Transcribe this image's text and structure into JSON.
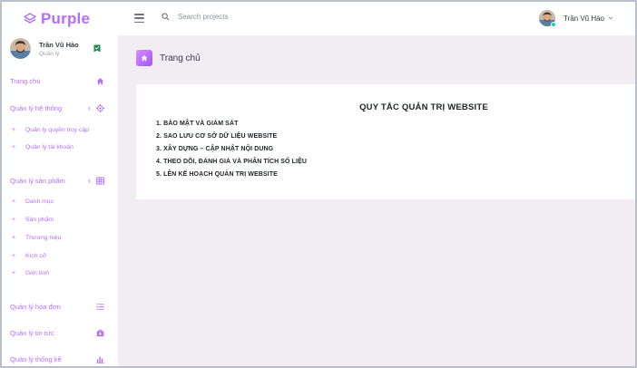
{
  "brand": {
    "name": "Purple"
  },
  "topbar": {
    "search_placeholder": "Search projects",
    "user_name": "Trần Vũ Hào"
  },
  "profile": {
    "name": "Trần Vũ Hào",
    "role": "Quản lý"
  },
  "sidebar": {
    "home": {
      "label": "Trang chủ",
      "icon": "home-icon"
    },
    "system": {
      "label": "Quản lý hệ thống",
      "icon": "crosshairs-icon",
      "sub": [
        "Quản lý quyền truy cập",
        "Quản lý tài khoản"
      ]
    },
    "products": {
      "label": "Quản lý sản phẩm",
      "icon": "table-icon",
      "sub": [
        "Danh mục",
        "Sản phẩm",
        "Thương hiệu",
        "Kích cỡ",
        "Giới tính"
      ]
    },
    "orders": {
      "label": "Quản lý hóa đơn",
      "icon": "list-icon"
    },
    "news": {
      "label": "Quản lý tin tức",
      "icon": "medical-bag-icon"
    },
    "stats": {
      "label": "Quản lý thống kê",
      "icon": "chart-bar-icon"
    }
  },
  "page": {
    "title": "Trang chủ"
  },
  "card": {
    "title": "QUY TẮC QUẢN TRỊ WEBSITE",
    "items": [
      "1. BẢO MẬT VÀ GIÁM SÁT",
      "2. SAO LƯU CƠ SỞ DỮ LIỆU WEBSITE",
      "3. XÂY DỰNG – CẬP NHẬT NỘI DUNG",
      "4. THEO DÕI, ĐÁNH GIÁ VÀ PHÂN TÍCH SỐ LIỆU",
      "5. LÊN KẾ HOẠCH QUẢN TRỊ WEBSITE"
    ]
  },
  "colors": {
    "accent": "#b66dff",
    "background": "#f2edf3",
    "online": "#1bcfb4",
    "badge": "#1e8c4e"
  }
}
